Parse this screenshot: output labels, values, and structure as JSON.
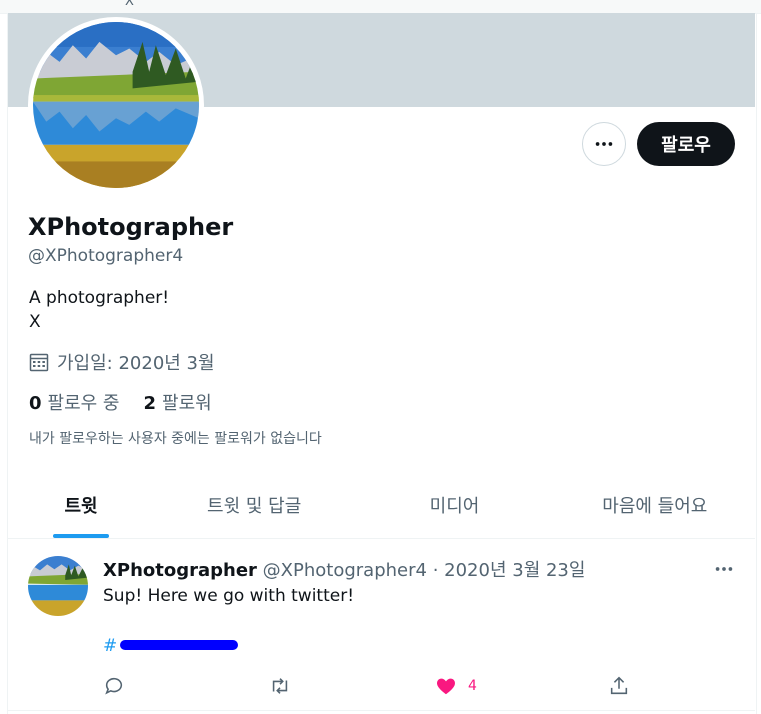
{
  "top_strip": {
    "close_glyph": "X"
  },
  "profile": {
    "display_name": "XPhotographer",
    "handle": "@XPhotographer4",
    "bio_line1": "A photographer!",
    "bio_line2": "X",
    "joined": "가입일: 2020년 3월",
    "following_count": "0",
    "following_label": "팔로우 중",
    "followers_count": "2",
    "followers_label": "팔로워",
    "no_mutual_followers": "내가 팔로우하는 사용자 중에는 팔로워가 없습니다"
  },
  "buttons": {
    "follow_label": "팔로우",
    "more_icon": "more-horizontal-icon"
  },
  "tabs": [
    {
      "label": "트윗",
      "active": true
    },
    {
      "label": "트윗 및 답글",
      "active": false
    },
    {
      "label": "미디어",
      "active": false
    },
    {
      "label": "마음에 들어요",
      "active": false
    }
  ],
  "tweet": {
    "author_name": "XPhotographer",
    "author_handle": "@XPhotographer4",
    "separator": "·",
    "date": "2020년 3월 23일",
    "text": "Sup! Here we go with twitter!",
    "hashtag_prefix": "#",
    "like_count": "4",
    "icons": [
      "reply-icon",
      "retweet-icon",
      "heart-icon",
      "share-icon"
    ]
  },
  "colors": {
    "accent": "#1d9bf0",
    "like": "#f91880",
    "banner": "#cfd9de",
    "follow_bg": "#0f1419"
  }
}
